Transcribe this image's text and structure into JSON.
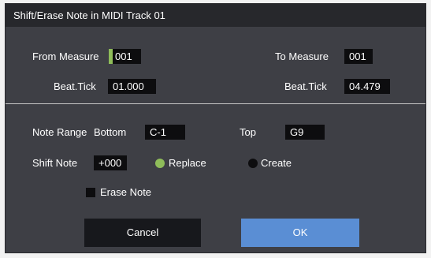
{
  "dialog": {
    "title": "Shift/Erase Note in MIDI Track 01"
  },
  "range": {
    "from_measure_label": "From Measure",
    "from_measure_value": "001",
    "to_measure_label": "To Measure",
    "to_measure_value": "001",
    "from_beat_label": "Beat.Tick",
    "from_beat_value": "01.000",
    "to_beat_label": "Beat.Tick",
    "to_beat_value": "04.479"
  },
  "note": {
    "range_label": "Note Range",
    "bottom_label": "Bottom",
    "bottom_value": "C-1",
    "top_label": "Top",
    "top_value": "G9",
    "shift_label": "Shift Note",
    "shift_value": "+000",
    "replace_label": "Replace",
    "create_label": "Create",
    "selected_mode": "Replace",
    "erase_label": "Erase Note",
    "erase_checked": false
  },
  "buttons": {
    "cancel": "Cancel",
    "ok": "OK"
  },
  "colors": {
    "accent": "#8fbd5a",
    "ok_button": "#5a8ed4",
    "panel": "#3e3f45"
  }
}
